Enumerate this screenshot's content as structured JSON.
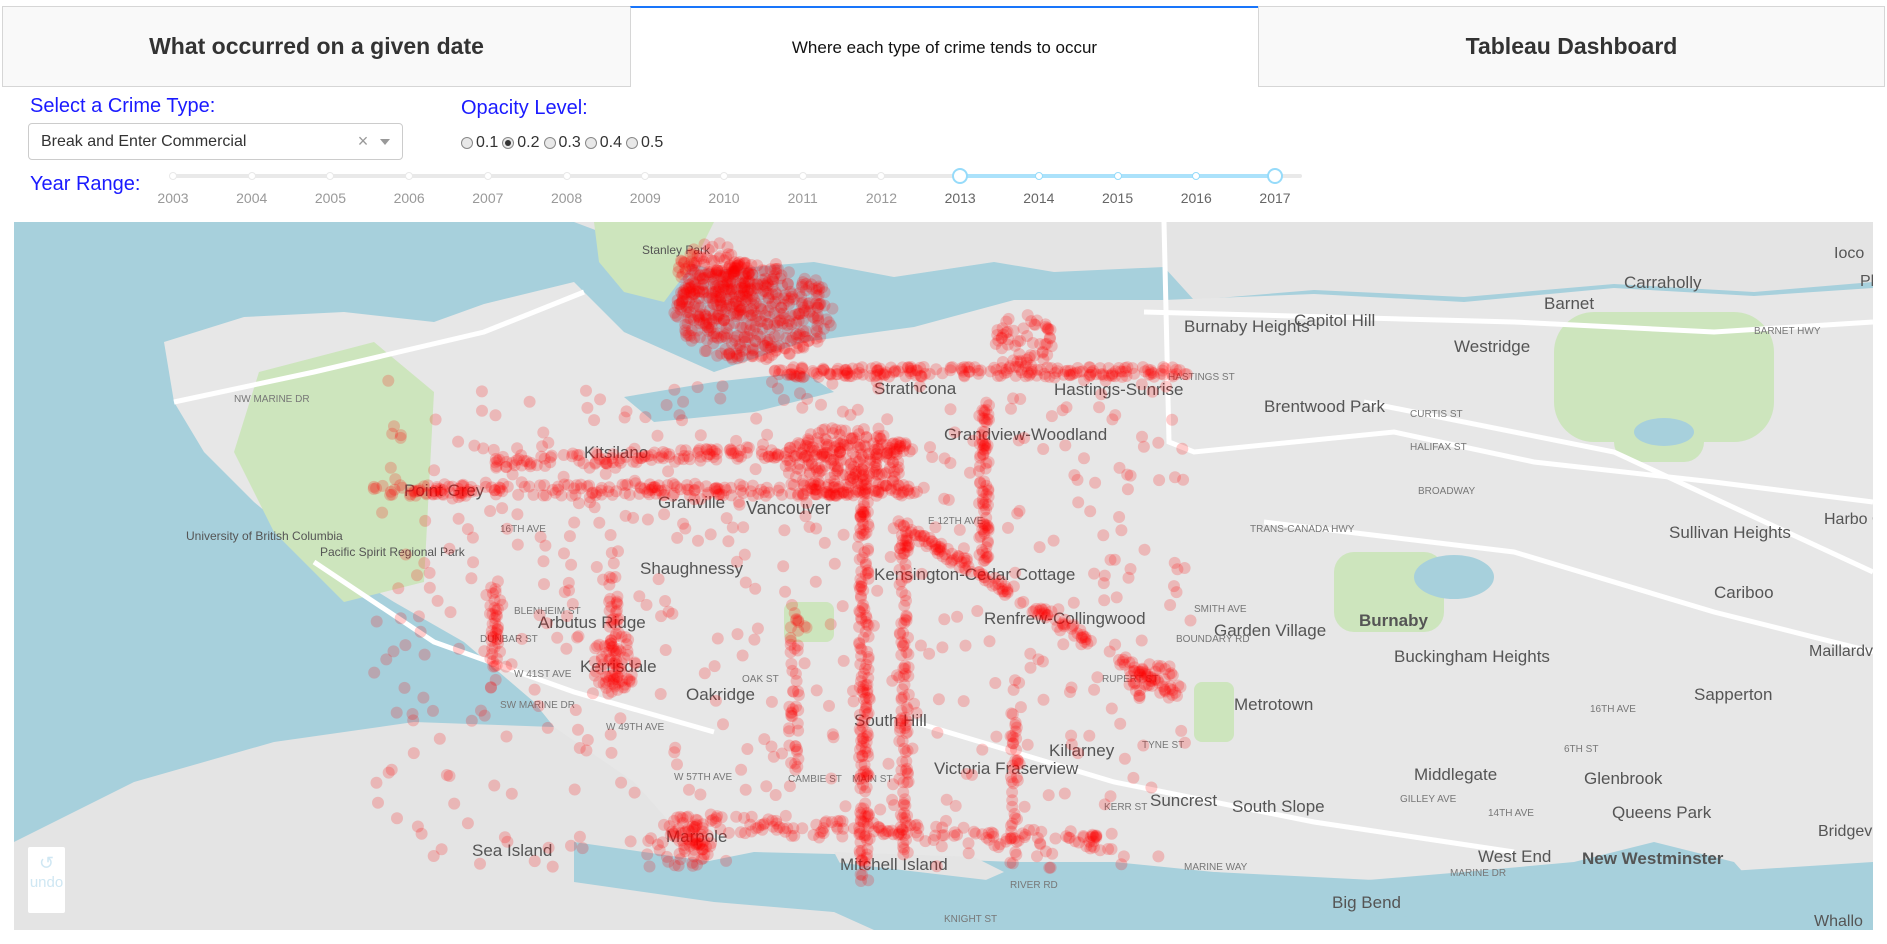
{
  "tabs": [
    {
      "label": "What occurred on a given date"
    },
    {
      "label": "Where each type of crime tends to occur"
    },
    {
      "label": "Tableau Dashboard"
    }
  ],
  "crime_type": {
    "label": "Select a Crime Type:",
    "value": "Break and Enter Commercial",
    "clear_symbol": "×"
  },
  "opacity": {
    "label": "Opacity Level:",
    "options": [
      "0.1",
      "0.2",
      "0.3",
      "0.4",
      "0.5"
    ],
    "selected": "0.2"
  },
  "year_range": {
    "label": "Year Range:",
    "years": [
      "2003",
      "2004",
      "2005",
      "2006",
      "2007",
      "2008",
      "2009",
      "2010",
      "2011",
      "2012",
      "2013",
      "2014",
      "2015",
      "2016",
      "2017"
    ],
    "selected_start": "2013",
    "selected_end": "2017"
  },
  "map": {
    "points_color": "#ff0000",
    "places": [
      "Stanley Park",
      "Carraholly",
      "Barnet",
      "Ioco",
      "Burnaby Heights",
      "Capitol Hill",
      "Westridge",
      "Hastings-Sunrise",
      "Brentwood Park",
      "Strathcona",
      "Grandview-Woodland",
      "Kitsilano",
      "Point Grey",
      "Granville",
      "Vancouver",
      "University of British Columbia",
      "Pacific Spirit Regional Park",
      "Shaughnessy",
      "Kensington-Cedar Cottage",
      "Renfrew-Collingwood",
      "Garden Village",
      "Burnaby",
      "Buckingham Heights",
      "Sullivan Heights",
      "Cariboo",
      "Maillardville",
      "Arbutus Ridge",
      "Kerrisdale",
      "Oakridge",
      "South Hill",
      "Metrotown",
      "Sapperton",
      "Killarney",
      "Victoria Fraserview",
      "Suncrest",
      "Middlegate",
      "Glenbrook",
      "South Slope",
      "Queens Park",
      "Marpole",
      "Sea Island",
      "Mitchell Island",
      "West End",
      "New Westminster",
      "Big Bend",
      "Bridgev",
      "Harbo Chin",
      "Whallo",
      "Pl"
    ],
    "streets": [
      "NW MARINE DR",
      "HASTINGS ST",
      "CURTIS ST",
      "HALIFAX ST",
      "BROADWAY",
      "16TH AVE",
      "E 12TH AVE",
      "TRANS-CANADA HWY",
      "BLENHEIM ST",
      "DUNBAR ST",
      "W 41ST AVE",
      "SW MARINE DR",
      "W 49TH AVE",
      "W 57TH AVE",
      "CAMBIE ST",
      "OAK ST",
      "MAIN ST",
      "RUPERT ST",
      "BOUNDARY RD",
      "SMITH AVE",
      "TYNE ST",
      "KERR ST",
      "GILLEY AVE",
      "16TH AVE",
      "14TH AVE",
      "6TH ST",
      "BARNET HWY",
      "MARINE WAY",
      "RIVER RD",
      "KNIGHT ST",
      "MARINE DR"
    ]
  },
  "undo": {
    "label": "undo",
    "icon": "undo-arrow"
  }
}
